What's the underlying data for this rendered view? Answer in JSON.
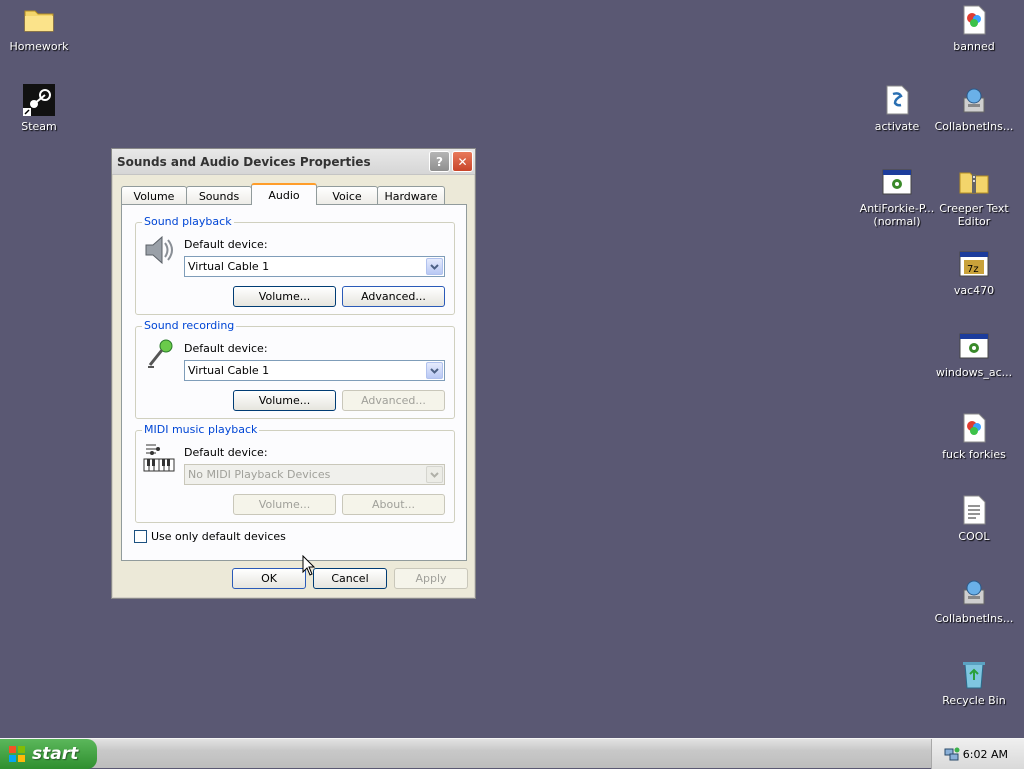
{
  "desktop": {
    "icons": [
      {
        "label": "Homework"
      },
      {
        "label": "Steam"
      },
      {
        "label": "banned"
      },
      {
        "label": "activate"
      },
      {
        "label": "CollabnetIns..."
      },
      {
        "label": "AntiForkie-P...\n(normal)"
      },
      {
        "label": "Creeper Text Editor"
      },
      {
        "label": "vac470"
      },
      {
        "label": "windows_ac..."
      },
      {
        "label": "fuck forkies"
      },
      {
        "label": "COOL"
      },
      {
        "label": "CollabnetIns..."
      },
      {
        "label": "Recycle Bin"
      }
    ]
  },
  "dialog": {
    "title": "Sounds and Audio Devices Properties",
    "help_glyph": "?",
    "close_glyph": "✕",
    "tabs": [
      {
        "label": "Volume"
      },
      {
        "label": "Sounds"
      },
      {
        "label": "Audio"
      },
      {
        "label": "Voice"
      },
      {
        "label": "Hardware"
      }
    ],
    "sound_playback": {
      "legend": "Sound playback",
      "default_label": "Default device:",
      "device": "Virtual Cable 1",
      "volume_button": "Volume...",
      "advanced_button": "Advanced..."
    },
    "sound_recording": {
      "legend": "Sound recording",
      "default_label": "Default device:",
      "device": "Virtual Cable 1",
      "volume_button": "Volume...",
      "advanced_button": "Advanced..."
    },
    "midi": {
      "legend": "MIDI music playback",
      "default_label": "Default device:",
      "device": "No MIDI Playback Devices",
      "volume_button": "Volume...",
      "about_button": "About..."
    },
    "use_default_label": "Use only default devices",
    "ok": "OK",
    "cancel": "Cancel",
    "apply": "Apply"
  },
  "taskbar": {
    "start_label": "start",
    "clock": "6:02 AM"
  },
  "colors": {
    "desktop_bg": "#5a5873",
    "accent_blue": "#0046d5",
    "tab_highlight": "#ff9d2a"
  }
}
